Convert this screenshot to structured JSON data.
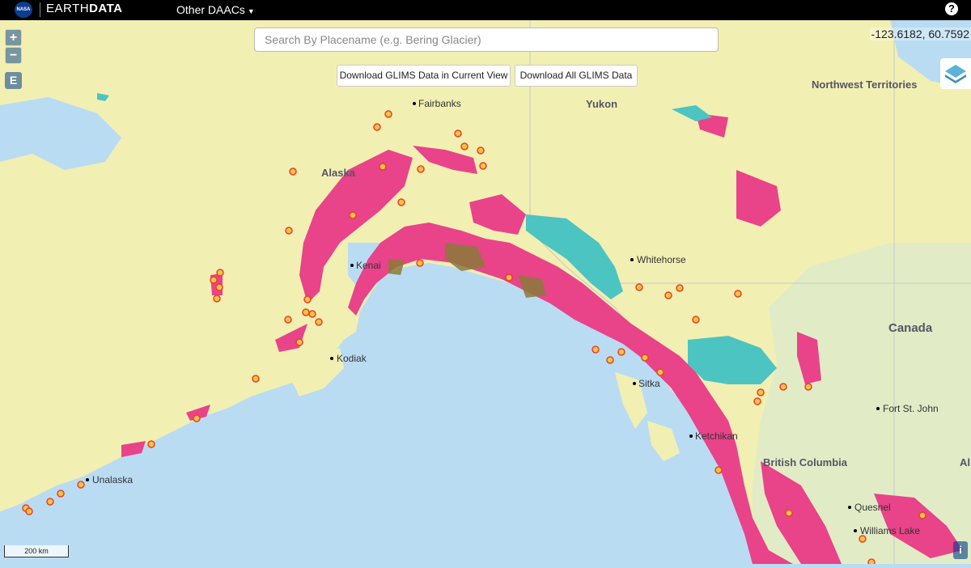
{
  "header": {
    "nasa_logo": "NASA",
    "brand_thin": "EARTH",
    "brand_bold": "DATA",
    "menu_label": "Other DAACs",
    "help_icon": "question-circle-icon"
  },
  "controls": {
    "zoom_in": "+",
    "zoom_out": "−",
    "extent": "E",
    "search_placeholder": "Search By Placename (e.g. Bering Glacier)",
    "download_view": "Download GLIMS Data in Current View",
    "download_all": "Download All GLIMS Data",
    "coordinates": "-123.6182, 60.7592",
    "layers_icon": "layers-icon",
    "scale": "200 km",
    "info": "i"
  },
  "colors": {
    "water": "#b9dcf3",
    "land": "#f2efb3",
    "land_green": "#e1ecc6",
    "glacier_pink": "#e94389",
    "glacier_teal": "#4cc4c2",
    "glacier_olive": "#8a7a3a",
    "marker_fill": "#f6c343",
    "marker_stroke": "#e8412a"
  },
  "places": [
    {
      "name": "Fairbanks",
      "dot": true
    },
    {
      "name": "Yukon",
      "dot": false,
      "bold": true
    },
    {
      "name": "Northwest Territories",
      "dot": false,
      "bold": true
    },
    {
      "name": "Alaska",
      "dot": false,
      "bold": true
    },
    {
      "name": "Kenai",
      "dot": true
    },
    {
      "name": "Whitehorse",
      "dot": true
    },
    {
      "name": "Canada",
      "dot": false,
      "bold": true,
      "large": true
    },
    {
      "name": "Kodiak",
      "dot": true
    },
    {
      "name": "Sitka",
      "dot": true
    },
    {
      "name": "Fort St. John",
      "dot": true
    },
    {
      "name": "Ketchikan",
      "dot": true
    },
    {
      "name": "British Columbia",
      "dot": false,
      "bold": true
    },
    {
      "name": "Unalaska",
      "dot": true
    },
    {
      "name": "Quesnel",
      "dot": true
    },
    {
      "name": "Williams Lake",
      "dot": true
    },
    {
      "name": "Al",
      "dot": false,
      "bold": true
    }
  ]
}
